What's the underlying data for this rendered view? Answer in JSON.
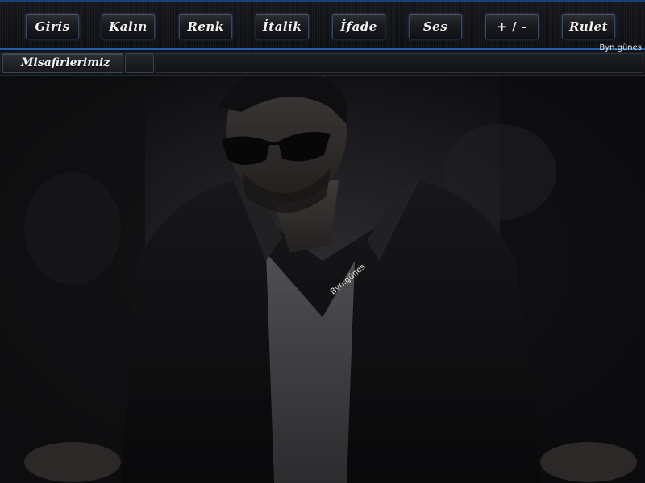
{
  "toolbar": {
    "buttons": [
      {
        "label": "Giris"
      },
      {
        "label": "Kalın"
      },
      {
        "label": "Renk"
      },
      {
        "label": "İtalik"
      },
      {
        "label": "İfade"
      },
      {
        "label": "Ses"
      },
      {
        "label": "+ / -"
      },
      {
        "label": "Rulet"
      }
    ],
    "watermark": "Byn.günes"
  },
  "guests": {
    "label": "Misafirlerimiz"
  },
  "photo": {
    "watermark": "Byn.günes"
  },
  "colors": {
    "accent": "#2a5c9c",
    "button_text": "#f2f2f2",
    "background": "#0d0d10"
  }
}
